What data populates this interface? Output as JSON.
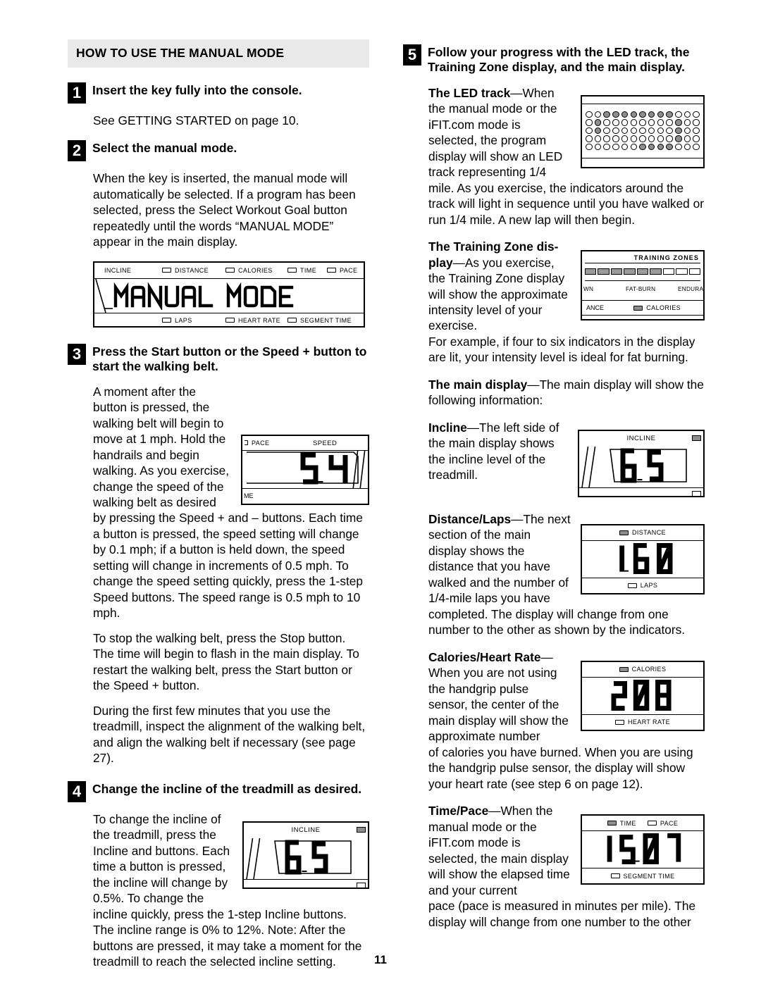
{
  "page": {
    "number": "11"
  },
  "left": {
    "banner": "HOW TO USE THE MANUAL MODE",
    "step1": {
      "num": "1",
      "title": "Insert the key fully into the console.",
      "body": "See GETTING STARTED on page 10."
    },
    "step2": {
      "num": "2",
      "title": "Select the manual mode.",
      "body": "When the key is inserted, the manual mode will automatically be selected. If a program has been selected, press the Select Workout Goal button repeatedly until the words “MANUAL MODE” appear in the main display."
    },
    "manual_panel": {
      "display_text": "MANUAL MODE",
      "top_indicators": [
        {
          "label": "INCLINE",
          "box": false,
          "lit": false
        },
        {
          "label": "DISTANCE",
          "box": true,
          "lit": false
        },
        {
          "label": "CALORIES",
          "box": true,
          "lit": false
        },
        {
          "label": "TIME",
          "box": true,
          "lit": false
        },
        {
          "label": "PACE",
          "box": true,
          "lit": false
        }
      ],
      "bottom_indicators": [
        {
          "label": "LAPS",
          "box": true,
          "lit": false
        },
        {
          "label": "HEART RATE",
          "box": true,
          "lit": false
        },
        {
          "label": "SEGMENT TIME",
          "box": true,
          "lit": false
        }
      ]
    },
    "step3": {
      "num": "3",
      "title": "Press the Start button or the Speed + button to start the walking belt.",
      "p1": "A moment after the button is pressed, the walking belt will begin to move at 1 mph. Hold the handrails and begin walking. As you exercise, change the speed of the walking belt as desired by pressing the Speed + and – buttons. Each time a button is pressed, the speed setting will change by 0.1 mph; if a button is held down, the speed setting will change in increments of 0.5 mph. To change the speed setting quickly, press the 1-step Speed buttons. The speed range is 0.5 mph to 10 mph.",
      "p2": "To stop the walking belt, press the Stop button. The time will begin to flash in the main display. To restart the walking belt, press the Start button or the Speed + button.",
      "p3": "During the first few minutes that you use the treadmill, inspect the alignment of the walking belt, and align the walking belt if necessary (see page 27)."
    },
    "speed_panel": {
      "label_left": "PACE",
      "label_right": "SPEED",
      "value": "5.4",
      "label_bottom": "ME"
    },
    "step4": {
      "num": "4",
      "title": "Change the incline of the treadmill as desired.",
      "body": "To change the incline of the treadmill, press the Incline and buttons. Each time a button is pressed, the incline will change by 0.5%. To change the incline quickly, press the 1-step Incline buttons. The incline range is 0% to 12%. Note: After the buttons are pressed, it may take a moment for the treadmill to reach the selected incline setting."
    },
    "incline_panel_step4": {
      "label": "INCLINE",
      "value": "6.5"
    }
  },
  "right": {
    "step5": {
      "num": "5",
      "title": "Follow your progress with the LED track, the Training Zone display, and the main display."
    },
    "led_track": {
      "lead": "The LED track",
      "dash": "—",
      "text_inline": "When the manual mode or the iFIT.com mode is selected, the program display will show an LED track representing 1/4",
      "text_after": "mile. As you exercise, the indicators around the track will light in sequence until you have walked or run 1/4 mile. A new lap will then begin.",
      "rows": [
        [
          0,
          0,
          1,
          1,
          1,
          1,
          1,
          1,
          1,
          1,
          0,
          0,
          0
        ],
        [
          0,
          1,
          0,
          0,
          0,
          0,
          0,
          0,
          0,
          0,
          1,
          0,
          0
        ],
        [
          0,
          1,
          0,
          0,
          0,
          0,
          0,
          0,
          0,
          0,
          1,
          0,
          0
        ],
        [
          0,
          0,
          0,
          0,
          0,
          0,
          0,
          0,
          0,
          0,
          1,
          0,
          0
        ],
        [
          0,
          0,
          0,
          0,
          0,
          0,
          1,
          1,
          1,
          1,
          0,
          0,
          0
        ]
      ]
    },
    "training_zone": {
      "lead": "The Training Zone dis-play",
      "lead_line1": "The Training Zone dis-",
      "lead_line2": "play",
      "dash": "—",
      "text_inline": "As you exercise, the Training Zone display will show the approximate intensity level of your exercise.",
      "text_after": "For example, if four to six indicators in the display are lit, your intensity level is ideal for fat burning.",
      "panel_title": "TRAINING ZONES",
      "bars": [
        1,
        1,
        1,
        1,
        1,
        1,
        0,
        0,
        0
      ],
      "zone_labels": [
        "WN",
        "FAT-BURN",
        "ENDURA"
      ],
      "lower_left": "ANCE",
      "lower_center": "CALORIES"
    },
    "main_display": {
      "lead": "The main display",
      "dash": "—",
      "text": "The main display will show the following information:"
    },
    "incline": {
      "lead": "Incline",
      "dash": "—",
      "text": "The left side of the main display shows the incline level of the treadmill.",
      "panel": {
        "label": "INCLINE",
        "value": "6.5"
      }
    },
    "distance": {
      "lead": "Distance/Laps",
      "dash": "—",
      "text_inline": "The next section of the main display shows the distance that you have walked and the number of 1/4-mile laps you have",
      "text_after": "completed. The display will change from one number to the other as shown by the indicators.",
      "panel": {
        "top_label": "DISTANCE",
        "top_lit": true,
        "value": "1.60",
        "bottom_label": "LAPS",
        "bottom_lit": false
      }
    },
    "calories": {
      "lead": "Calories/Heart Rate",
      "dash": "—",
      "text_inline": "When you are not using the handgrip pulse sensor, the center of the main display will show the approximate number",
      "text_after": "of calories you have burned. When you are using the handgrip pulse sensor, the display will show your heart rate (see step 6 on page 12).",
      "panel": {
        "top_label": "CALORIES",
        "top_lit": true,
        "value": "208",
        "bottom_label": "HEART RATE",
        "bottom_lit": false
      }
    },
    "time": {
      "lead": "Time/Pace",
      "dash": "—",
      "text_inline": "When the manual mode or the iFIT.com mode is selected, the main display will show the elapsed time and your current",
      "text_after": "pace (pace is measured in minutes per mile). The display will change from one number to the other",
      "panel": {
        "top_label_1": "TIME",
        "top_lit_1": true,
        "top_label_2": "PACE",
        "top_lit_2": false,
        "value": "15.07",
        "bottom_label": "SEGMENT TIME",
        "bottom_lit": false
      }
    }
  }
}
